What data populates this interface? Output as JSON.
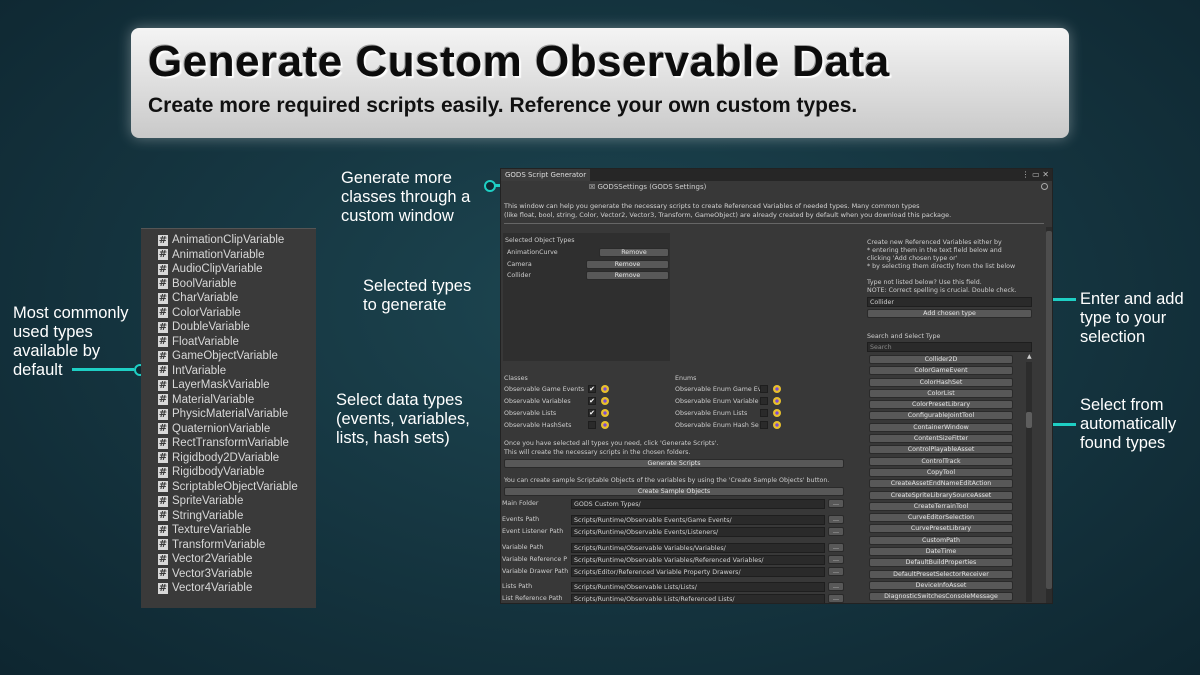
{
  "banner": {
    "title": "Generate Custom Observable Data",
    "subtitle": "Create more required scripts easily. Reference your own custom types."
  },
  "callouts": {
    "generate": [
      "Generate more",
      "classes through a",
      "custom window"
    ],
    "selected": [
      "Selected types",
      "to generate"
    ],
    "select_data": [
      "Select data types",
      "(events, variables,",
      "lists, hash sets)"
    ],
    "most_common": [
      "Most commonly",
      "used types",
      "available by",
      "default"
    ],
    "enter_add": [
      "Enter and add",
      "type to your",
      "selection"
    ],
    "select_from": [
      "Select from",
      "automatically",
      "found types"
    ]
  },
  "type_list": [
    "AnimationClipVariable",
    "AnimationVariable",
    "AudioClipVariable",
    "BoolVariable",
    "CharVariable",
    "ColorVariable",
    "DoubleVariable",
    "FloatVariable",
    "GameObjectVariable",
    "IntVariable",
    "LayerMaskVariable",
    "MaterialVariable",
    "PhysicMaterialVariable",
    "QuaternionVariable",
    "RectTransformVariable",
    "Rigidbody2DVariable",
    "RigidbodyVariable",
    "ScriptableObjectVariable",
    "SpriteVariable",
    "StringVariable",
    "TextureVariable",
    "TransformVariable",
    "Vector2Variable",
    "Vector3Variable",
    "Vector4Variable"
  ],
  "window": {
    "tab_title": "GODS Script Generator",
    "window_controls": "⋮ ▭ ✕",
    "settings_field": "☒ GODSSettings (GODS Settings)",
    "intro_lines": [
      "This window can help you generate the necessary scripts to create Referenced Variables of needed types. Many common types",
      "(like float, bool, string, Color, Vector2, Vector3, Transform, GameObject) are already created by default when you download this package."
    ],
    "selected_heading": "Selected Object Types",
    "selected_items": [
      "AnimationCurve",
      "Camera",
      "Collider"
    ],
    "remove_label": "Remove",
    "classes_heading": "Classes",
    "classes": [
      "Observable Game Events",
      "Observable Variables",
      "Observable Lists",
      "Observable HashSets"
    ],
    "enums_heading": "Enums",
    "enums": [
      "Observable Enum Game Ev",
      "Observable Enum Variable",
      "Observable Enum Lists",
      "Observable Enum Hash Se"
    ],
    "check_mark": "✔",
    "generate_note": [
      "Once you have selected all types you need, click 'Generate Scripts'.",
      "This will create the necessary scripts in the chosen folders."
    ],
    "generate_button": "Generate Scripts",
    "sample_note": "You can create sample Scriptable Objects of the variables by using the 'Create Sample Objects' button.",
    "sample_button": "Create Sample Objects",
    "browse_label": "...",
    "paths": [
      {
        "label": "Main Folder",
        "value": "GODS Custom Types/"
      },
      {
        "label": "Events Path",
        "value": "Scripts/Runtime/Observable Events/Game Events/"
      },
      {
        "label": "Event Listener Path",
        "value": "Scripts/Runtime/Observable Events/Listeners/"
      },
      {
        "label": "Variable Path",
        "value": "Scripts/Runtime/Observable Variables/Variables/"
      },
      {
        "label": "Variable Reference P",
        "value": "Scripts/Runtime/Observable Variables/Referenced Variables/"
      },
      {
        "label": "Variable Drawer Path",
        "value": "Scripts/Editor/Referenced Variable Property Drawers/"
      },
      {
        "label": "Lists Path",
        "value": "Scripts/Runtime/Observable Lists/Lists/"
      },
      {
        "label": "List Reference Path",
        "value": "Scripts/Runtime/Observable Lists/Referenced Lists/"
      }
    ],
    "right_info": [
      "Create new Referenced Variables either by",
      "* entering them in the text field below and",
      "   clicking 'Add chosen type or'",
      "* by selecting them directly from the list below"
    ],
    "not_listed": [
      "Type not listed below? Use this field.",
      "NOTE: Correct spelling is crucial. Double check."
    ],
    "type_input": "Collider",
    "add_button": "Add chosen type",
    "search_heading": "Search and Select Type",
    "search_placeholder": "Search",
    "found_types": [
      "Collider2D",
      "ColorGameEvent",
      "ColorHashSet",
      "ColorList",
      "ColorPresetLibrary",
      "ConfigurableJointTool",
      "ContainerWindow",
      "ContentSizeFitter",
      "ControlPlayableAsset",
      "ControlTrack",
      "CopyTool",
      "CreateAssetEndNameEditAction",
      "CreateSpriteLibrarySourceAsset",
      "CreateTerrainTool",
      "CurveEditorSelection",
      "CurvePresetLibrary",
      "CustomPath",
      "DateTime",
      "DefaultBuildProperties",
      "DefaultPresetSelectorReceiver",
      "DeviceInfoAsset",
      "DiagnosticSwitchesConsoleMessage"
    ]
  }
}
